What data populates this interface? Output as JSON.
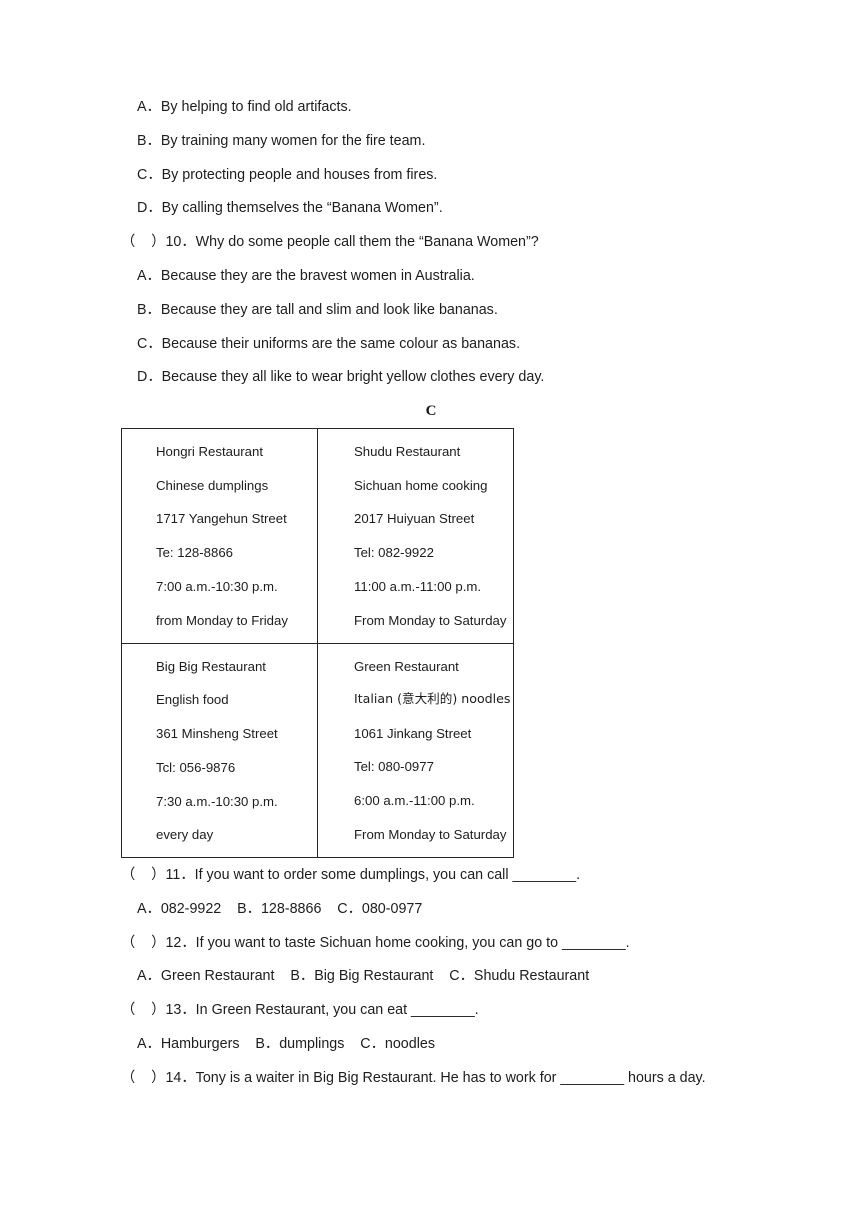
{
  "document": {
    "page_background": "#ffffff",
    "text_color": "#1d1d1d"
  },
  "question_9_options": [
    "A．By helping to find old artifacts.",
    "B．By training many women for the fire team.",
    "C．By protecting people and houses from fires.",
    "D．By calling themselves the “Banana Women”."
  ],
  "question_10": {
    "stem": "（    ）10．Why do some people call them the “Banana Women”?",
    "options": [
      "A．Because they are the bravest women in Australia.",
      "B．Because they are tall and slim and look like bananas.",
      "C．Because their uniforms are the same colour as bananas.",
      "D．Because they all like to wear bright yellow clothes every day."
    ]
  },
  "section": {
    "letter": "C"
  },
  "restaurant_table": {
    "rows": [
      {
        "cells": [
          {
            "name": "Hongri Restaurant",
            "lines": [
              "Hongri Restaurant",
              "Chinese dumplings",
              "1717 Yangehun Street",
              "Te: 128-8866",
              "7:00 a.m.-10:30 p.m.",
              "from Monday to Friday"
            ]
          },
          {
            "name": "Shudu Restaurant",
            "lines": [
              "Shudu Restaurant",
              "Sichuan home cooking",
              "2017 Huiyuan Street",
              "Tel: 082-9922",
              "11:00 a.m.-11:00 p.m.",
              "From Monday to Saturday"
            ]
          }
        ]
      },
      {
        "cells": [
          {
            "name": "Big Big Restaurant",
            "lines": [
              "Big Big Restaurant",
              "English food",
              "361 Minsheng Street",
              "Tcl: 056-9876",
              "7:30 a.m.-10:30 p.m.",
              "every day"
            ]
          },
          {
            "name": "Green Restaurant",
            "lines": [
              "Green Restaurant",
              "Italian (意大利的) noodles",
              "1061 Jinkang Street",
              "Tel: 080-0977",
              "6:00 a.m.-11:00 p.m.",
              "From Monday to Saturday"
            ]
          }
        ]
      }
    ]
  },
  "question_11": {
    "stem": "（    ）11．If you want to order some dumplings, you can call ________.",
    "options_line": "A．082-9922    B．128-8866    C．080-0977"
  },
  "question_12": {
    "stem": "（    ）12．If you want to taste Sichuan home cooking, you can go to ________.",
    "options_line": "A．Green Restaurant    B．Big Big Restaurant    C．Shudu Restaurant"
  },
  "question_13": {
    "stem": "（    ）13．In Green Restaurant, you can eat ________.",
    "options_line": "A．Hamburgers    B．dumplings    C．noodles"
  },
  "question_14": {
    "stem": "（    ）14．Tony is a waiter in Big Big Restaurant. He has to work for ________ hours a day."
  }
}
